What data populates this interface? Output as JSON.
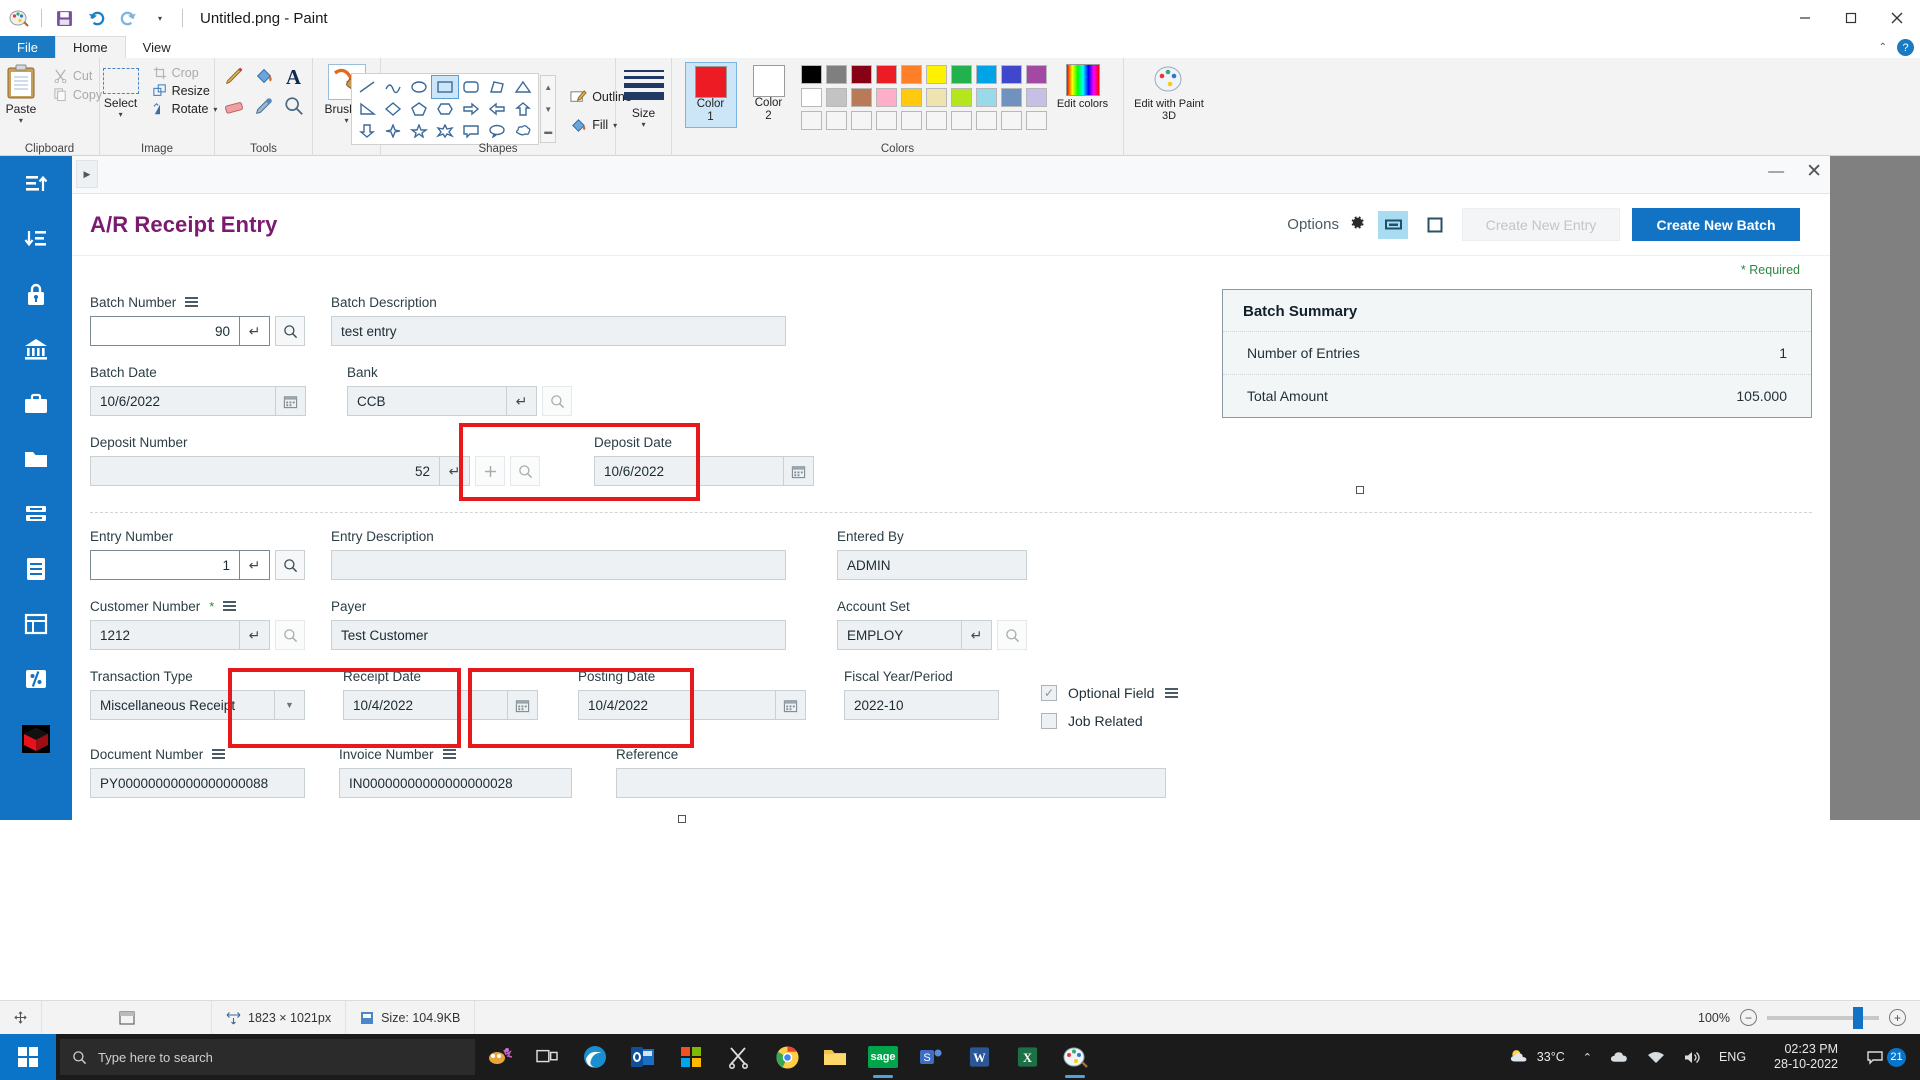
{
  "paint": {
    "window_title": "Untitled.png - Paint",
    "quick_access": [
      "paint-logo",
      "save-icon",
      "undo-icon",
      "redo-icon",
      "customize-caret"
    ],
    "window_controls": {
      "minimize": "—",
      "maximize": "▢",
      "close": "✕"
    },
    "tabs": [
      {
        "id": "file",
        "label": "File"
      },
      {
        "id": "home",
        "label": "Home"
      },
      {
        "id": "view",
        "label": "View"
      }
    ],
    "ribbon_collapse_icon": "chevron-up-icon",
    "help_icon": "?",
    "groups": {
      "clipboard": {
        "label": "Clipboard",
        "paste": "Paste",
        "cut": "Cut",
        "copy": "Copy"
      },
      "image": {
        "label": "Image",
        "select": "Select",
        "crop": "Crop",
        "resize": "Resize",
        "rotate": "Rotate"
      },
      "tools": {
        "label": "Tools",
        "items": [
          "pencil-icon",
          "fill-icon",
          "text-icon",
          "eraser-icon",
          "color-picker-icon",
          "magnifier-icon"
        ]
      },
      "brushes": {
        "label": "Brushes"
      },
      "shapes": {
        "label": "Shapes",
        "outline": "Outline",
        "fill": "Fill",
        "selected_shape": "rectangle"
      },
      "size": {
        "label": "Size"
      },
      "colors": {
        "label": "Colors",
        "color1_label": "Color",
        "color1_num": "1",
        "color2_label": "Color",
        "color2_num": "2",
        "color1_value": "#ed1c24",
        "color2_value": "#ffffff",
        "edit_colors": "Edit colors",
        "palette_row1": [
          "#000000",
          "#7f7f7f",
          "#880015",
          "#ed1c24",
          "#ff7f27",
          "#fff200",
          "#22b14c",
          "#00a2e8",
          "#3f48cc",
          "#a349a4"
        ],
        "palette_row2": [
          "#ffffff",
          "#c3c3c3",
          "#b97a57",
          "#ffaec9",
          "#ffc90e",
          "#efe4b0",
          "#b5e61d",
          "#99d9ea",
          "#7092be",
          "#c8bfe7"
        ],
        "palette_row3": [
          "#f5f5f5",
          "#f5f5f5",
          "#f5f5f5",
          "#f5f5f5",
          "#f5f5f5",
          "#f5f5f5",
          "#f5f5f5",
          "#f5f5f5",
          "#f5f5f5",
          "#f5f5f5"
        ]
      },
      "paint3d": {
        "label": "Edit with Paint 3D"
      }
    },
    "status": {
      "dimensions": "1823 × 1021px",
      "size": "Size: 104.9KB",
      "zoom": "100%"
    }
  },
  "sage": {
    "window_controls": {
      "minimize": "—",
      "close": "✕"
    },
    "title": "A/R Receipt Entry",
    "options_label": "Options",
    "create_new_entry": "Create New Entry",
    "create_new_batch": "Create New Batch",
    "required_note": "* Required",
    "batch": {
      "batch_number_label": "Batch Number",
      "batch_number_value": "90",
      "batch_description_label": "Batch Description",
      "batch_description_value": "test entry",
      "batch_date_label": "Batch Date",
      "batch_date_value": "10/6/2022",
      "bank_label": "Bank",
      "bank_value": "CCB",
      "deposit_number_label": "Deposit Number",
      "deposit_number_value": "52",
      "deposit_date_label": "Deposit Date",
      "deposit_date_value": "10/6/2022"
    },
    "summary": {
      "title": "Batch Summary",
      "rows": [
        {
          "label": "Number of Entries",
          "value": "1"
        },
        {
          "label": "Total Amount",
          "value": "105.000"
        }
      ]
    },
    "entry": {
      "entry_number_label": "Entry Number",
      "entry_number_value": "1",
      "entry_description_label": "Entry Description",
      "entry_description_value": "",
      "entered_by_label": "Entered By",
      "entered_by_value": "ADMIN",
      "customer_number_label": "Customer Number",
      "customer_number_value": "1212",
      "payer_label": "Payer",
      "payer_value": "Test Customer",
      "account_set_label": "Account Set",
      "account_set_value": "EMPLOY",
      "transaction_type_label": "Transaction Type",
      "transaction_type_value": "Miscellaneous Receipt",
      "receipt_date_label": "Receipt Date",
      "receipt_date_value": "10/4/2022",
      "posting_date_label": "Posting Date",
      "posting_date_value": "10/4/2022",
      "fiscal_label": "Fiscal Year/Period",
      "fiscal_value": "2022-10",
      "optional_field_label": "Optional Field",
      "job_related_label": "Job Related",
      "document_number_label": "Document Number",
      "document_number_value": "PY00000000000000000088",
      "invoice_number_label": "Invoice Number",
      "invoice_number_value": "IN00000000000000000028",
      "reference_label": "Reference",
      "reference_value": ""
    },
    "annotation_color": "#e8191a"
  },
  "taskbar": {
    "search_placeholder": "Type here to search",
    "apps": [
      "cortana-icon",
      "task-view-icon",
      "edge-icon",
      "outlook-icon",
      "store-icon",
      "scissors-icon",
      "chrome-icon",
      "explorer-icon",
      "sage-icon",
      "teams-icon",
      "word-icon",
      "excel-icon",
      "paint-icon"
    ],
    "tray": {
      "weather": "33°C",
      "language": "ENG",
      "time": "02:23 PM",
      "date": "28-10-2022",
      "notification_count": "21"
    }
  }
}
